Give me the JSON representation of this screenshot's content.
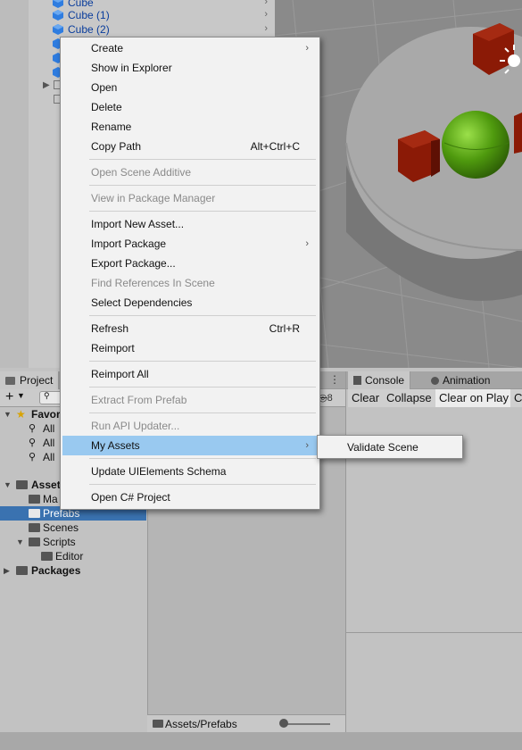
{
  "hierarchy": {
    "items": [
      "Cube",
      "Cube (1)",
      "Cube (2)"
    ]
  },
  "context_menu": {
    "items": [
      {
        "label": "Create",
        "has_submenu": true
      },
      {
        "label": "Show in Explorer"
      },
      {
        "label": "Open"
      },
      {
        "label": "Delete"
      },
      {
        "label": "Rename"
      },
      {
        "label": "Copy Path",
        "shortcut": "Alt+Ctrl+C"
      },
      {
        "label": "Open Scene Additive",
        "disabled": true
      },
      {
        "label": "View in Package Manager",
        "disabled": true
      },
      {
        "label": "Import New Asset..."
      },
      {
        "label": "Import Package",
        "has_submenu": true
      },
      {
        "label": "Export Package..."
      },
      {
        "label": "Find References In Scene",
        "disabled": true
      },
      {
        "label": "Select Dependencies"
      },
      {
        "label": "Refresh",
        "shortcut": "Ctrl+R"
      },
      {
        "label": "Reimport"
      },
      {
        "label": "Reimport All"
      },
      {
        "label": "Extract From Prefab",
        "disabled": true
      },
      {
        "label": "Run API Updater...",
        "disabled": true
      },
      {
        "label": "My Assets",
        "has_submenu": true,
        "highlighted": true
      },
      {
        "label": "Update UIElements Schema"
      },
      {
        "label": "Open C# Project"
      }
    ],
    "submenu": {
      "items": [
        "Validate Scene"
      ]
    }
  },
  "project_panel": {
    "tab_label": "Project",
    "badge_count": "8",
    "tree": {
      "favorites": "Favor",
      "favorite_items": [
        "All",
        "All",
        "All"
      ],
      "assets": "Asset",
      "asset_children": [
        "Ma",
        "Prefabs",
        "Scenes",
        "Scripts"
      ],
      "scripts_children": [
        "Editor"
      ],
      "packages": "Packages"
    },
    "path": "Assets/Prefabs",
    "zoom_level": 0
  },
  "console_panel": {
    "tabs": [
      "Console",
      "Animation"
    ],
    "buttons": [
      "Clear",
      "Collapse",
      "Clear on Play",
      "C"
    ]
  },
  "colors": {
    "selection": "#3a72b0",
    "menu_highlight": "#99c9f0",
    "hierarchy_text": "#0a3d9c",
    "cube_red": "#8b1a06",
    "sphere_green": "#4f9a0e"
  }
}
